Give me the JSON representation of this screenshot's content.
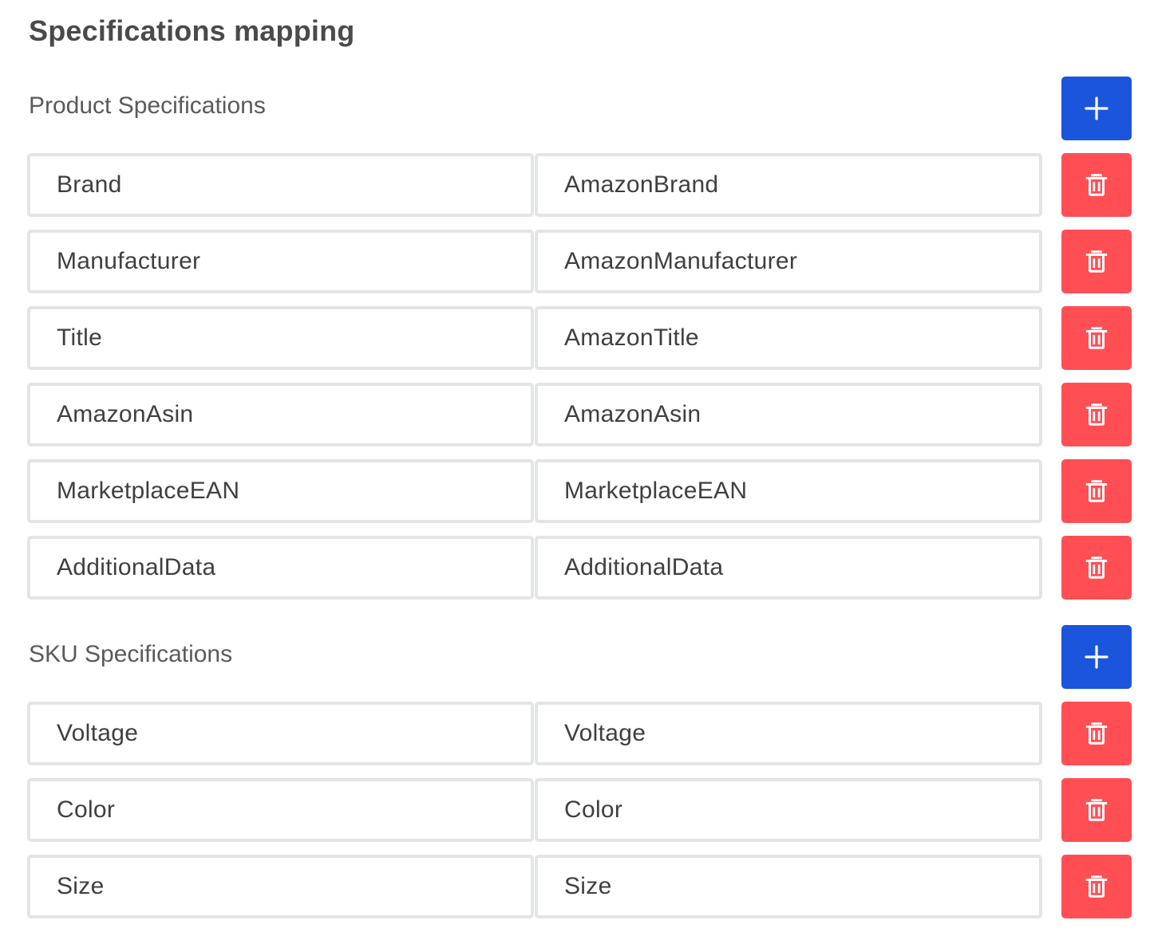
{
  "page_title": "Specifications mapping",
  "colors": {
    "add_button": "#1a55db",
    "delete_button": "#ff4f55",
    "field_border": "#e3e4e6"
  },
  "sections": [
    {
      "title": "Product Specifications",
      "add_icon": "plus-icon",
      "rows": [
        {
          "source": "Brand",
          "target": "AmazonBrand"
        },
        {
          "source": "Manufacturer",
          "target": "AmazonManufacturer"
        },
        {
          "source": "Title",
          "target": "AmazonTitle"
        },
        {
          "source": "AmazonAsin",
          "target": "AmazonAsin"
        },
        {
          "source": "MarketplaceEAN",
          "target": "MarketplaceEAN"
        },
        {
          "source": "AdditionalData",
          "target": "AdditionalData"
        }
      ]
    },
    {
      "title": "SKU Specifications",
      "add_icon": "plus-icon",
      "rows": [
        {
          "source": "Voltage",
          "target": "Voltage"
        },
        {
          "source": "Color",
          "target": "Color"
        },
        {
          "source": "Size",
          "target": "Size"
        }
      ]
    }
  ],
  "delete_icon": "trash-icon"
}
